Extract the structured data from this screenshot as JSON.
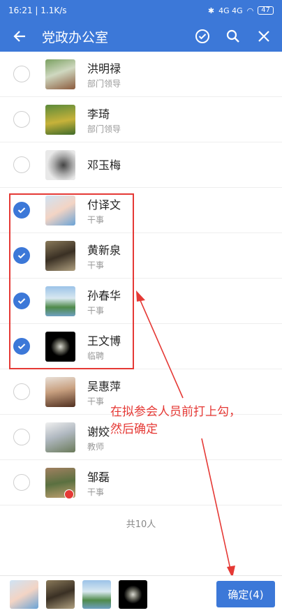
{
  "status_bar": {
    "time": "16:21",
    "speed": "1.1K/s",
    "signal": "4G 4G",
    "battery": "47"
  },
  "app_bar": {
    "title": "党政办公室"
  },
  "members": [
    {
      "name": "洪明禄",
      "role": "部门领导",
      "checked": false
    },
    {
      "name": "李琦",
      "role": "部门领导",
      "checked": false
    },
    {
      "name": "邓玉梅",
      "role": "",
      "checked": false
    },
    {
      "name": "付译文",
      "role": "干事",
      "checked": true
    },
    {
      "name": "黄新泉",
      "role": "干事",
      "checked": true
    },
    {
      "name": "孙春华",
      "role": "干事",
      "checked": true
    },
    {
      "name": "王文博",
      "role": "临聘",
      "checked": true
    },
    {
      "name": "吴惠萍",
      "role": "干事",
      "checked": false
    },
    {
      "name": "谢姣",
      "role": "教师",
      "checked": false
    },
    {
      "name": "邹磊",
      "role": "干事",
      "checked": false
    }
  ],
  "total_label": "共10人",
  "confirm_label": "确定(4)",
  "annotation": {
    "line1": "在拟参会人员前打上勾，",
    "line2": "然后确定"
  },
  "colors": {
    "primary": "#3c78d8",
    "annotation": "#e53935"
  }
}
